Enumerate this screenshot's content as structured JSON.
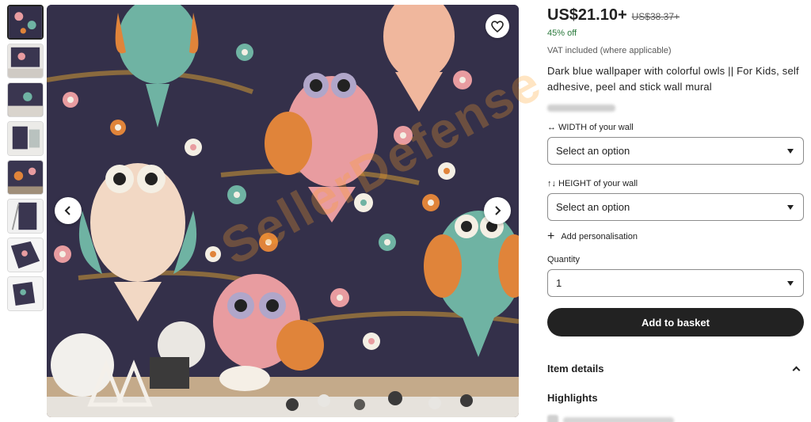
{
  "thumbnails": [
    {
      "label": "thumbnail-1",
      "active": true
    },
    {
      "label": "thumbnail-2"
    },
    {
      "label": "thumbnail-3"
    },
    {
      "label": "thumbnail-4"
    },
    {
      "label": "thumbnail-5"
    },
    {
      "label": "thumbnail-6"
    },
    {
      "label": "thumbnail-7"
    },
    {
      "label": "thumbnail-8"
    }
  ],
  "product": {
    "price": "US$21.10+",
    "old_price": "US$38.37+",
    "discount": "45% off",
    "vat_note": "VAT included (where applicable)",
    "title": "Dark blue wallpaper with colorful owls || For Kids, self adhesive, peel and stick wall mural"
  },
  "options": {
    "width_icon": "↔",
    "width_label": "WIDTH of your wall",
    "width_value": "Select an option",
    "height_icon": "↑↓",
    "height_label": "HEIGHT of your wall",
    "height_value": "Select an option",
    "add_personalisation": "Add personalisation",
    "quantity_label": "Quantity",
    "quantity_value": "1"
  },
  "actions": {
    "add_to_basket": "Add to basket"
  },
  "sections": {
    "item_details": "Item details",
    "highlights": "Highlights"
  },
  "watermark": "SellerDefense",
  "colors": {
    "primary_button": "#222222",
    "discount_green": "#2b7a3d",
    "wallpaper_bg": "#34304a",
    "watermark": "#ffa028"
  }
}
